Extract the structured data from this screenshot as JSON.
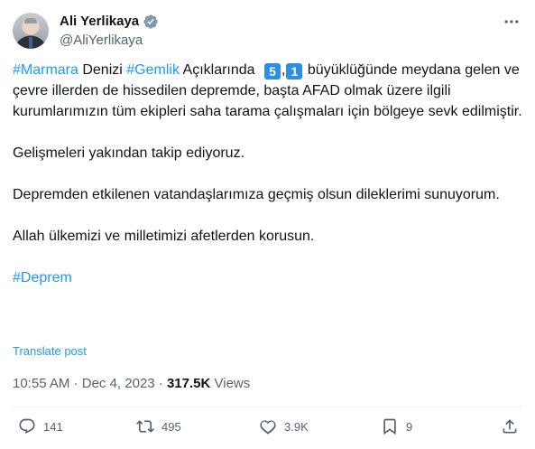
{
  "author": {
    "display_name": "Ali Yerlikaya",
    "handle": "@AliYerlikaya",
    "verified": true
  },
  "tweet": {
    "line1_tag1": "#Marmara",
    "line1_text1": " Denizi ",
    "line1_tag2": "#Gemlik",
    "line1_text2": " Açıklarında ",
    "magnitude_digit1": "5",
    "magnitude_sep": ",",
    "magnitude_digit2": "1",
    "line1_text3": " büyüklüğünde meydana gelen ve çevre illerden de hissedilen depremde, başta AFAD olmak üzere ilgili kurumlarımızın tüm ekipleri saha tarama çalışmaları için bölgeye sevk edilmiştir.",
    "paragraph2": "Gelişmeleri yakından takip ediyoruz.",
    "paragraph3": "Depremden etkilenen vatandaşlarımıza geçmiş olsun dileklerimi sunuyorum.",
    "paragraph4": "Allah ülkemizi ve milletimizi afetlerden korusun.",
    "hashtag_final": "#Deprem"
  },
  "translate_label": "Translate post",
  "meta": {
    "time": "10:55 AM",
    "separator": " · ",
    "date": "Dec 4, 2023",
    "separator2": " · ",
    "views_count": "317.5K",
    "views_label": " Views"
  },
  "actions": {
    "replies": "141",
    "reposts": "495",
    "likes": "3.9K",
    "bookmarks": "9"
  },
  "colors": {
    "link": "#1d9bf0",
    "secondary_text": "#536471",
    "keycap": "#2d8ee6"
  }
}
